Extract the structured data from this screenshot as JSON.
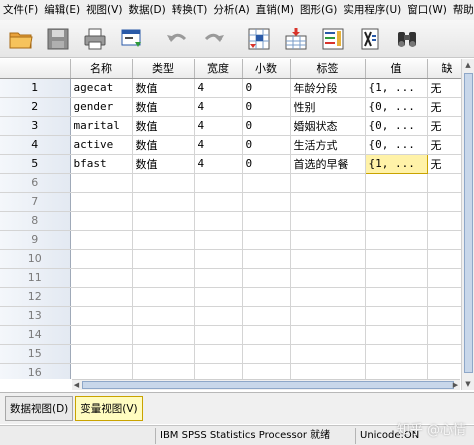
{
  "menu": [
    {
      "label": "文件(F)"
    },
    {
      "label": "编辑(E)"
    },
    {
      "label": "视图(V)"
    },
    {
      "label": "数据(D)"
    },
    {
      "label": "转换(T)"
    },
    {
      "label": "分析(A)"
    },
    {
      "label": "直销(M)"
    },
    {
      "label": "图形(G)"
    },
    {
      "label": "实用程序(U)"
    },
    {
      "label": "窗口(W)"
    },
    {
      "label": "帮助(H)"
    }
  ],
  "toolbar": {
    "icons": [
      "open-folder-icon",
      "save-icon",
      "print-icon",
      "dialog-recall-icon",
      "undo-icon",
      "redo-icon",
      "goto-case-icon",
      "goto-variable-icon",
      "variables-icon",
      "split-file-icon",
      "find-icon"
    ]
  },
  "grid": {
    "columns": [
      "",
      "名称",
      "类型",
      "宽度",
      "小数",
      "标签",
      "值",
      "缺"
    ],
    "rows": [
      {
        "num": "1",
        "name": "agecat",
        "type": "数值",
        "width": "4",
        "decimals": "0",
        "label": "年龄分段",
        "values": "{1, ...",
        "missing": "无"
      },
      {
        "num": "2",
        "name": "gender",
        "type": "数值",
        "width": "4",
        "decimals": "0",
        "label": "性别",
        "values": "{0, ...",
        "missing": "无"
      },
      {
        "num": "3",
        "name": "marital",
        "type": "数值",
        "width": "4",
        "decimals": "0",
        "label": "婚姻状态",
        "values": "{0, ...",
        "missing": "无"
      },
      {
        "num": "4",
        "name": "active",
        "type": "数值",
        "width": "4",
        "decimals": "0",
        "label": "生活方式",
        "values": "{0, ...",
        "missing": "无"
      },
      {
        "num": "5",
        "name": "bfast",
        "type": "数值",
        "width": "4",
        "decimals": "0",
        "label": "首选的早餐",
        "values": "{1, ...",
        "missing": "无"
      }
    ],
    "empty_rows": [
      "6",
      "7",
      "8",
      "9",
      "10",
      "11",
      "12",
      "13",
      "14",
      "15",
      "16"
    ]
  },
  "tabs": [
    {
      "label": "数据视图(D)",
      "active": false
    },
    {
      "label": "变量视图(V)",
      "active": true
    }
  ],
  "status": {
    "processor": "IBM SPSS Statistics Processor 就绪",
    "unicode": "Unicode:ON"
  },
  "watermark": "知乎 @心情",
  "colors": {
    "selected_cell": "#fff2a8",
    "active_tab": "#fffcc0"
  }
}
